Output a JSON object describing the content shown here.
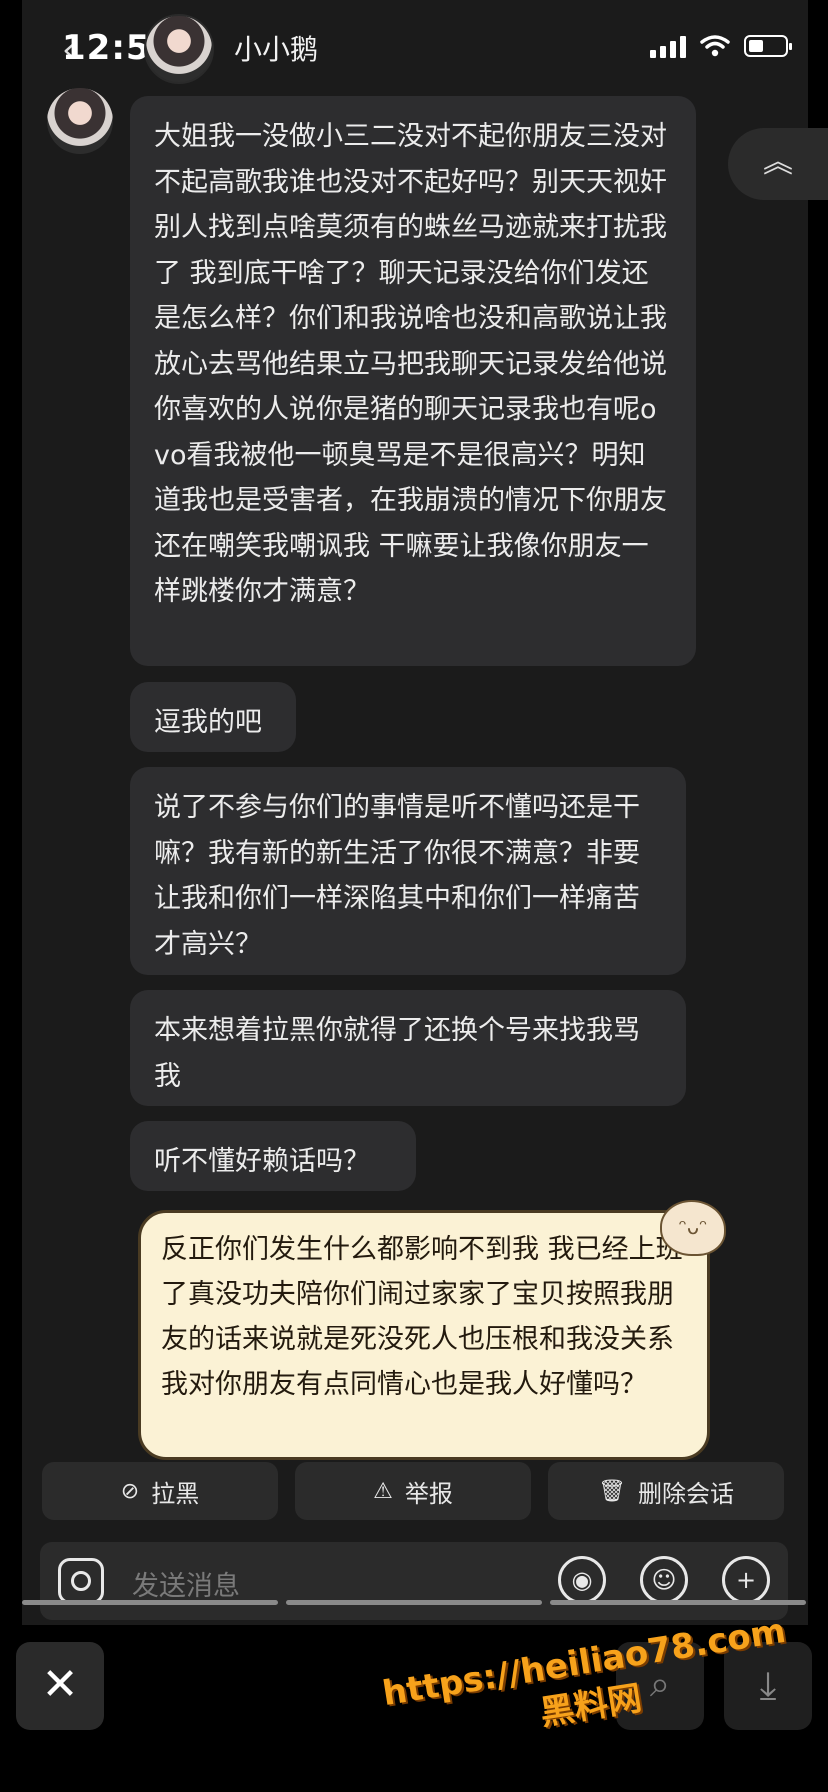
{
  "status": {
    "time": "12:56"
  },
  "header": {
    "contact_name": "小小鹅"
  },
  "messages": [
    "大姐我一没做小三二没对不起你朋友三没对不起高歌我谁也没对不起好吗？别天天视奸别人找到点啥莫须有的蛛丝马迹就来打扰我了 我到底干啥了？聊天记录没给你们发还是怎么样？你们和我说啥也没和高歌说让我放心去骂他结果立马把我聊天记录发给他说你喜欢的人说你是猪的聊天记录我也有呢ovo看我被他一顿臭骂是不是很高兴？明知道我也是受害者，在我崩溃的情况下你朋友还在嘲笑我嘲讽我 干嘛要让我像你朋友一样跳楼你才满意？",
    "逗我的吧",
    "说了不参与你们的事情是听不懂吗还是干嘛？我有新的新生活了你很不满意？非要让我和你们一样深陷其中和你们一样痛苦才高兴？",
    "本来想着拉黑你就得了还换个号来找我骂我",
    "听不懂好赖话吗？",
    "反正你们发生什么都影响不到我 我已经上班了真没功夫陪你们闹过家家了宝贝按照我朋友的话来说就是死没死人也压根和我没关系 我对你朋友有点同情心也是我人好懂吗？"
  ],
  "actions": {
    "block": "拉黑",
    "report": "举报",
    "delete": "删除会话"
  },
  "input": {
    "placeholder": "发送消息"
  },
  "watermark": {
    "url": "https://heiliao78.com",
    "name": "黑料网"
  }
}
